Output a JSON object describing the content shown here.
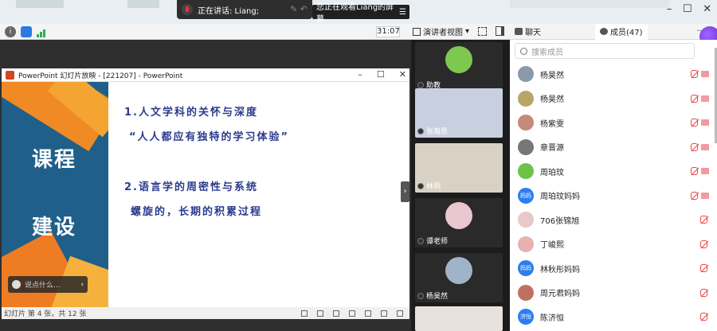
{
  "speaking": {
    "label": "正在讲话: Liang;"
  },
  "watching": {
    "label": "您正在观看Liang的屏幕"
  },
  "toolbar": {
    "timer": "31:07",
    "view_mode": "演讲者视图"
  },
  "panel": {
    "tabs": [
      {
        "label": "聊天"
      },
      {
        "label": "成员(47)"
      }
    ],
    "search_placeholder": "搜索成员",
    "more": "···"
  },
  "ppt": {
    "window_title": "PowerPoint 幻灯片放映 - [221207] - PowerPoint",
    "status": "幻灯片 第 4 张，共 12 张",
    "side_words": [
      "课程",
      "建设"
    ],
    "bullets": [
      "1.人文学科的关怀与深度",
      "“人人都应有独特的学习体验”",
      "2.语言学的周密性与系统",
      "螺旋的，长期的积累过程"
    ],
    "chat_placeholder": "说点什么..."
  },
  "videos": [
    {
      "name": "助教",
      "kind": "avatar",
      "color": "#7ec850"
    },
    {
      "name": "张瀚恩",
      "kind": "camera",
      "color": "#c8d0e0"
    },
    {
      "name": "林玥",
      "kind": "camera",
      "color": "#d9d2c4"
    },
    {
      "name": "谭老师",
      "kind": "avatar",
      "color": "#e9c6d0"
    },
    {
      "name": "杨昊然",
      "kind": "avatar",
      "color": "#9fb4c8"
    }
  ],
  "members": [
    {
      "name": "杨昊然",
      "avatar": "photo",
      "color": "#8a9aa8",
      "cam": true
    },
    {
      "name": "杨昊然",
      "avatar": "photo",
      "color": "#b9a56a",
      "cam": true
    },
    {
      "name": "杨紫雯",
      "avatar": "photo",
      "color": "#c48a7a",
      "cam": true
    },
    {
      "name": "章晋源",
      "avatar": "photo",
      "color": "#777777",
      "cam": true
    },
    {
      "name": "周珀玟",
      "avatar": "photo",
      "color": "#6ec24a",
      "cam": true
    },
    {
      "name": "周珀玟妈妈",
      "avatar": "text",
      "text": "妈妈",
      "color": "#2b7ef0",
      "cam": true
    },
    {
      "name": "706张锦旭",
      "avatar": "photo",
      "color": "#e8c8c8",
      "cam": false
    },
    {
      "name": "丁峻熙",
      "avatar": "photo",
      "color": "#e8b0b0",
      "cam": false
    },
    {
      "name": "林秋彤妈妈",
      "avatar": "text",
      "text": "妈妈",
      "color": "#2b7ef0",
      "cam": false
    },
    {
      "name": "周元君妈妈",
      "avatar": "photo",
      "color": "#c07060",
      "cam": false
    },
    {
      "name": "陈济恒",
      "avatar": "text",
      "text": "济恒",
      "color": "#2b7ef0",
      "cam": false
    }
  ]
}
